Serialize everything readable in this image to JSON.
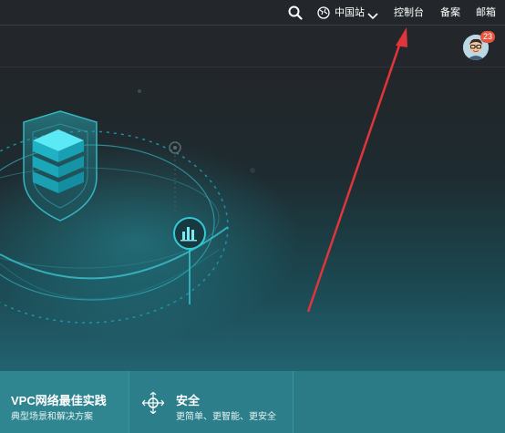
{
  "topbar": {
    "region_label": "中国站",
    "console_label": "控制台",
    "beian_label": "备案",
    "mail_label": "邮箱"
  },
  "user": {
    "notification_count": "23"
  },
  "cards": [
    {
      "title": "VPC网络最佳实践",
      "subtitle": "典型场景和解决方案"
    },
    {
      "title": "安全",
      "subtitle": "更简单、更智能、更安全"
    }
  ],
  "colors": {
    "annotation_arrow": "#e0353a",
    "badge": "#e8553e",
    "accent": "#26c6da"
  }
}
